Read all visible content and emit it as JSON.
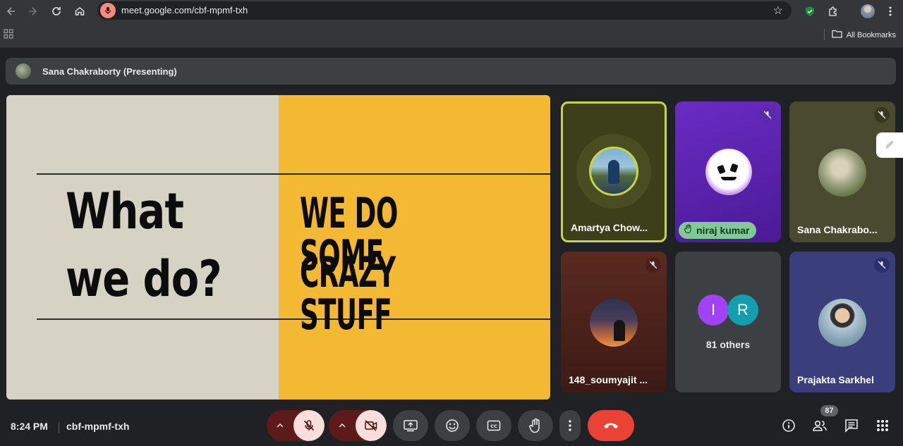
{
  "browser": {
    "url": "meet.google.com/cbf-mpmf-txh",
    "bookmarks_label": "All Bookmarks"
  },
  "presenting_banner": "Sana Chakraborty (Presenting)",
  "slide": {
    "left_line1": "What",
    "left_line2": "we do?",
    "right_line1": "WE DO SOME",
    "right_line2": "CRAZY STUFF"
  },
  "participants": [
    {
      "name": "Amartya Chow...",
      "speaking": true
    },
    {
      "name": "niraj kumar",
      "hand_raised": true,
      "muted": true
    },
    {
      "name": "Sana Chakrabo...",
      "muted": true
    },
    {
      "name": "148_soumyajit ...",
      "muted": true
    },
    {
      "name": "81 others",
      "initials": [
        "I",
        "R"
      ]
    },
    {
      "name": "Prajakta Sarkhel",
      "muted": true
    }
  ],
  "meeting": {
    "time": "8:24 PM",
    "code": "cbf-mpmf-txh",
    "people_count": "87"
  },
  "colors": {
    "leave_red": "#ea4335",
    "speaking_border": "#c6d63f",
    "hand_green": "#81c995",
    "slide_yellow": "#f4b933"
  }
}
